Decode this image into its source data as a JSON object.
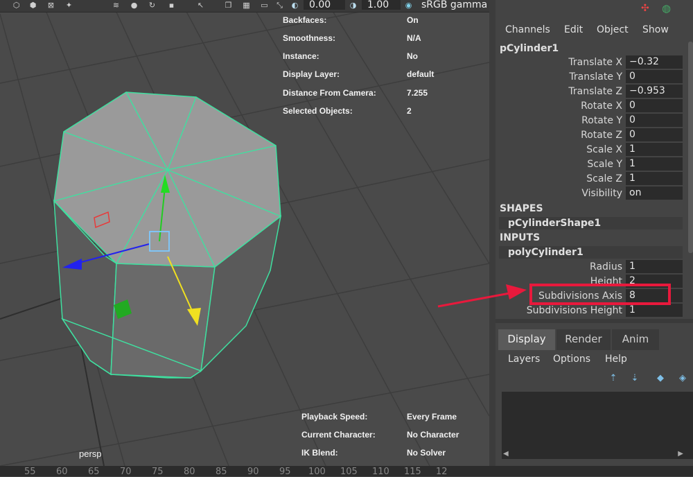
{
  "toolbar": {
    "exposure_value": "0.00",
    "gamma_value": "1.00",
    "colorspace": "sRGB gamma"
  },
  "hud_top": [
    {
      "label": "Backfaces:",
      "value": "On"
    },
    {
      "label": "Smoothness:",
      "value": "N/A"
    },
    {
      "label": "Instance:",
      "value": "No"
    },
    {
      "label": "Display Layer:",
      "value": "default"
    },
    {
      "label": "Distance From Camera:",
      "value": "7.255"
    },
    {
      "label": "Selected Objects:",
      "value": "2"
    }
  ],
  "hud_bottom": [
    {
      "label": "Playback Speed:",
      "value": "Every Frame"
    },
    {
      "label": "Current Character:",
      "value": "No Character"
    },
    {
      "label": "IK Blend:",
      "value": "No Solver"
    }
  ],
  "camera_label": "persp",
  "ruler_ticks": [
    "55",
    "60",
    "65",
    "70",
    "75",
    "80",
    "85",
    "90",
    "95",
    "100",
    "105",
    "110",
    "115",
    "12"
  ],
  "channel_box": {
    "menu": [
      "Channels",
      "Edit",
      "Object",
      "Show"
    ],
    "object_name": "pCylinder1",
    "attributes": [
      {
        "label": "Translate X",
        "value": "−0.32"
      },
      {
        "label": "Translate Y",
        "value": "0"
      },
      {
        "label": "Translate Z",
        "value": "−0.953"
      },
      {
        "label": "Rotate X",
        "value": "0"
      },
      {
        "label": "Rotate Y",
        "value": "0"
      },
      {
        "label": "Rotate Z",
        "value": "0"
      },
      {
        "label": "Scale X",
        "value": "1"
      },
      {
        "label": "Scale Y",
        "value": "1"
      },
      {
        "label": "Scale Z",
        "value": "1"
      },
      {
        "label": "Visibility",
        "value": "on"
      }
    ],
    "shapes_header": "SHAPES",
    "shape_node": "pCylinderShape1",
    "inputs_header": "INPUTS",
    "input_node": "polyCylinder1",
    "input_attributes": [
      {
        "label": "Radius",
        "value": "1"
      },
      {
        "label": "Height",
        "value": "2"
      },
      {
        "label": "Subdivisions Axis",
        "value": "8"
      },
      {
        "label": "Subdivisions Height",
        "value": "1"
      }
    ]
  },
  "layer_editor": {
    "tabs": [
      "Display",
      "Render",
      "Anim"
    ],
    "menu": [
      "Layers",
      "Options",
      "Help"
    ]
  },
  "colors": {
    "highlight": "#e8193c",
    "wireframe": "#3fe0a0"
  }
}
